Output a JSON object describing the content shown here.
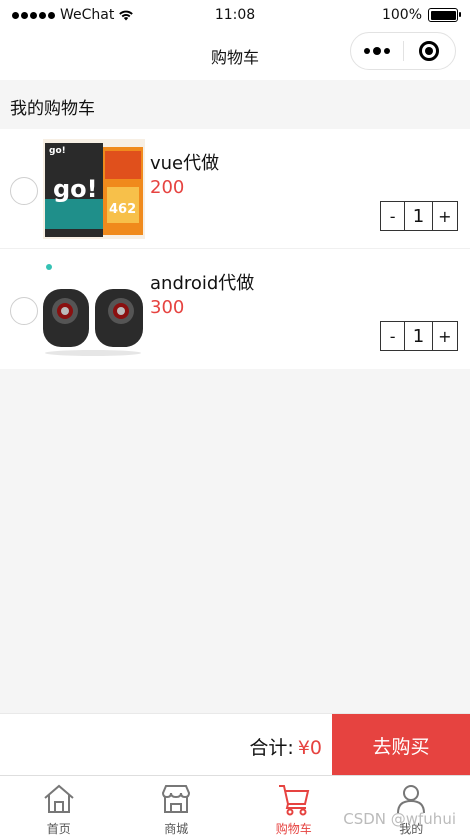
{
  "status_bar": {
    "carrier": "WeChat",
    "time": "11:08",
    "battery": "100%"
  },
  "nav": {
    "title": "购物车"
  },
  "section": {
    "title": "我的购物车"
  },
  "cart": {
    "items": [
      {
        "name": "vue代做",
        "price": "200",
        "quantity": "1",
        "minus": "-",
        "plus": "+",
        "image": "pet-food-bag"
      },
      {
        "name": "android代做",
        "price": "300",
        "quantity": "1",
        "minus": "-",
        "plus": "+",
        "image": "speakers"
      }
    ]
  },
  "checkout": {
    "total_label": "合计:",
    "total_amount": "¥0",
    "button_label": "去购买"
  },
  "tabs": [
    {
      "label": "首页",
      "icon": "home-icon"
    },
    {
      "label": "商城",
      "icon": "shop-icon"
    },
    {
      "label": "购物车",
      "icon": "cart-icon",
      "active": true
    },
    {
      "label": "我的",
      "icon": "user-icon"
    }
  ],
  "watermark": "CSDN @wfuhui",
  "colors": {
    "accent": "#e64340",
    "background": "#f5f5f5"
  }
}
